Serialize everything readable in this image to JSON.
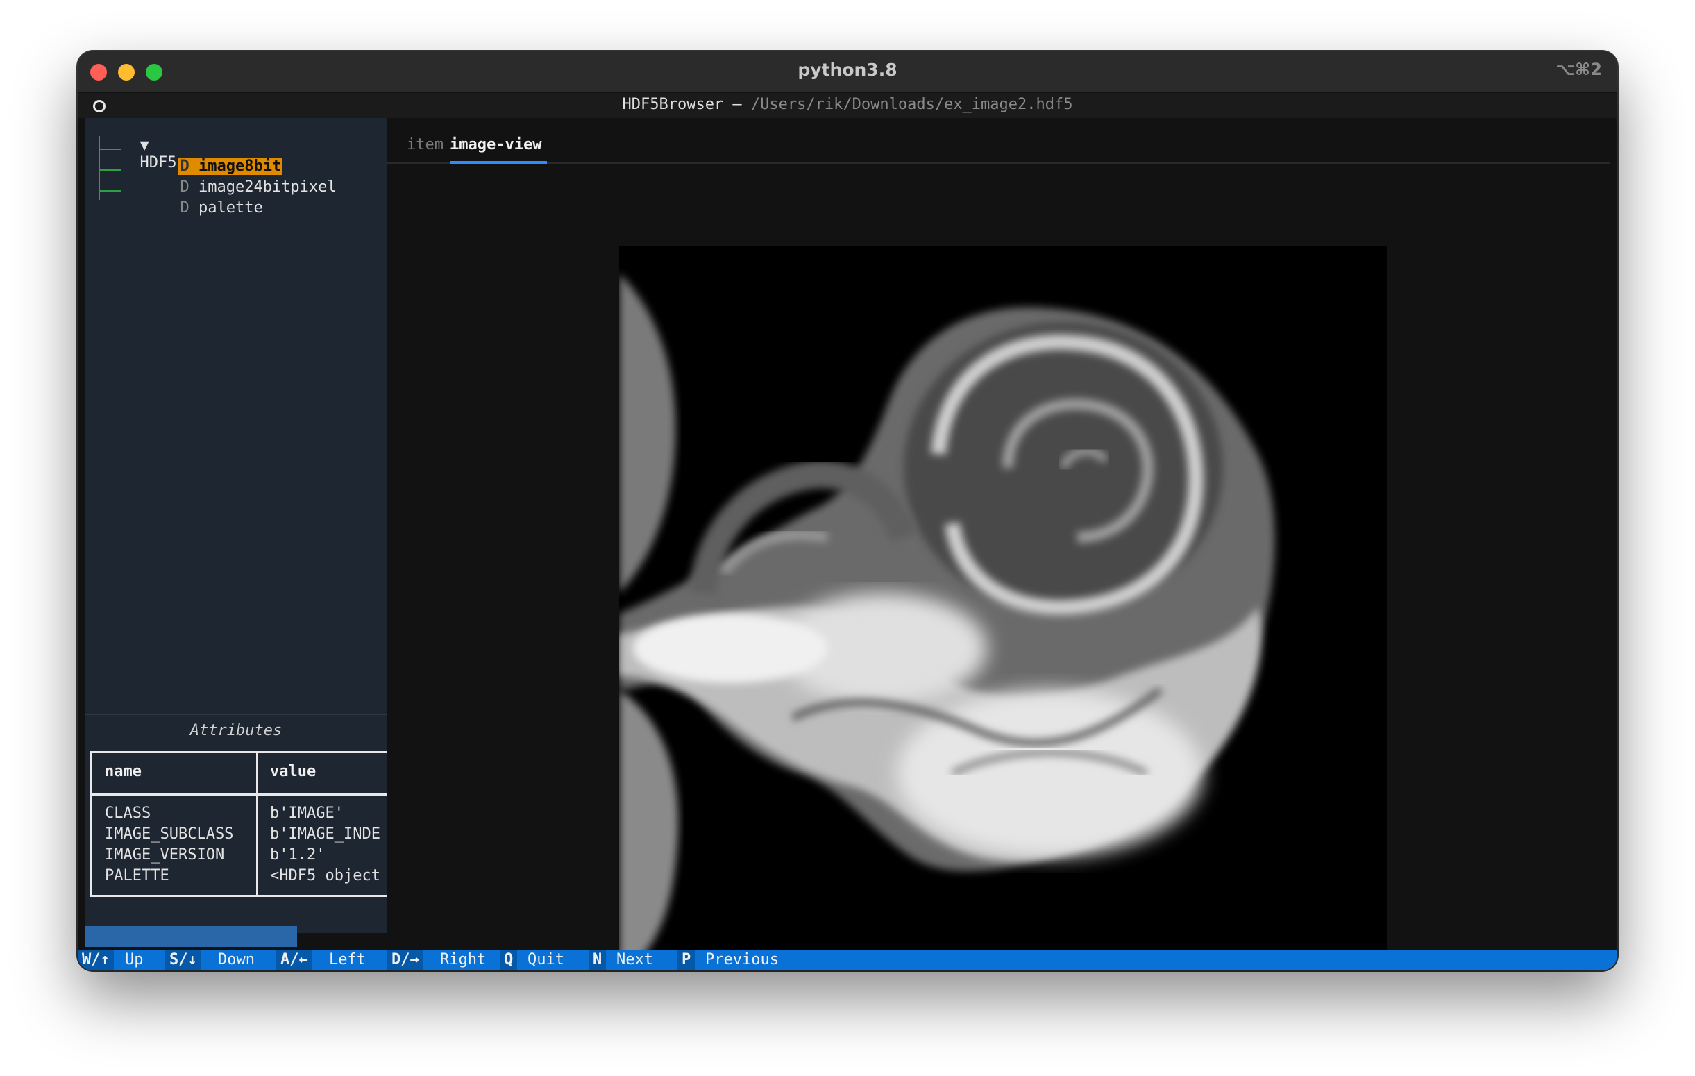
{
  "window": {
    "title": "python3.8",
    "shortcut": "⌥⌘2"
  },
  "app": {
    "name": "HDF5Browser —",
    "path": "/Users/rik/Downloads/ex_image2.hdf5"
  },
  "tree": {
    "root_toggle": "▼",
    "root_label": "HDF5",
    "items": [
      {
        "type": "D",
        "label": "image8bit",
        "selected": true
      },
      {
        "type": "D",
        "label": "image24bitpixel",
        "selected": false
      },
      {
        "type": "D",
        "label": "palette",
        "selected": false
      }
    ]
  },
  "attributes": {
    "title": "Attributes",
    "headers": [
      "name",
      "value"
    ],
    "rows": [
      {
        "name": "CLASS",
        "value": "b'IMAGE'"
      },
      {
        "name": "IMAGE_SUBCLASS",
        "value": "b'IMAGE_INDE"
      },
      {
        "name": "IMAGE_VERSION",
        "value": "b'1.2'"
      },
      {
        "name": "PALETTE",
        "value": "<HDF5 object"
      }
    ]
  },
  "tabs": [
    {
      "label": "item",
      "active": false
    },
    {
      "label": "image-view",
      "active": true
    }
  ],
  "footer": [
    {
      "key": "W/↑",
      "label": "Up"
    },
    {
      "key": "S/↓",
      "label": "Down"
    },
    {
      "key": "A/←",
      "label": "Left"
    },
    {
      "key": "D/→",
      "label": "Right"
    },
    {
      "key": "Q",
      "label": "Quit"
    },
    {
      "key": "N",
      "label": "Next"
    },
    {
      "key": "P",
      "label": "Previous"
    }
  ],
  "colors": {
    "accent": "#0a72d6",
    "selection": "#e08a00",
    "tree_lines": "#2ea043",
    "sidebar_bg": "#1e2631"
  }
}
